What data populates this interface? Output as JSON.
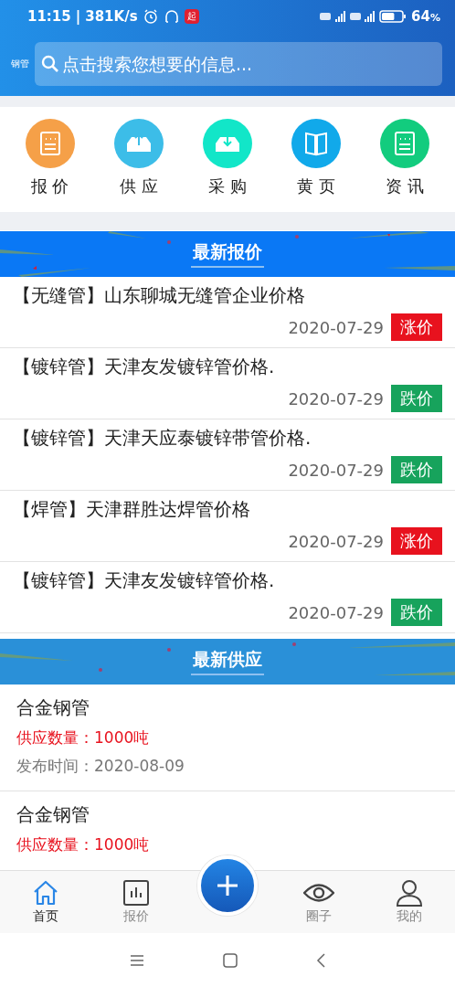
{
  "status_bar": {
    "time": "11:15",
    "separator": "|",
    "speed": "381K/s",
    "app_badge": "起",
    "battery_text": "64",
    "battery_unit": "%"
  },
  "header": {
    "logo": "钢管",
    "search": {
      "placeholder": "点击搜索您想要的信息..."
    }
  },
  "shortcuts": [
    {
      "label": "报 价",
      "kind": "doc",
      "color": "#f5a048"
    },
    {
      "label": "供 应",
      "kind": "upload",
      "color": "#3cbde8"
    },
    {
      "label": "采 购",
      "kind": "download",
      "color": "#12e6c8"
    },
    {
      "label": "黄 页",
      "kind": "book",
      "color": "#11a9ea"
    },
    {
      "label": "资 讯",
      "kind": "doc",
      "color": "#12cc7e"
    }
  ],
  "quotes": {
    "title": "最新报价",
    "items": [
      {
        "title": "【无缝管】山东聊城无缝管企业价格",
        "date": "2020-07-29",
        "tag": "涨价",
        "kind": "up"
      },
      {
        "title": "【镀锌管】天津友发镀锌管价格.",
        "date": "2020-07-29",
        "tag": "跌价",
        "kind": "down"
      },
      {
        "title": "【镀锌管】天津天应泰镀锌带管价格.",
        "date": "2020-07-29",
        "tag": "跌价",
        "kind": "down"
      },
      {
        "title": "【焊管】天津群胜达焊管价格",
        "date": "2020-07-29",
        "tag": "涨价",
        "kind": "up"
      },
      {
        "title": "【镀锌管】天津友发镀锌管价格.",
        "date": "2020-07-29",
        "tag": "跌价",
        "kind": "down"
      }
    ]
  },
  "supply": {
    "title": "最新供应",
    "items": [
      {
        "name": "合金钢管",
        "quantity": "供应数量：1000吨",
        "published": "发布时间：2020-08-09"
      },
      {
        "name": "合金钢管",
        "quantity": "供应数量：1000吨"
      }
    ]
  },
  "tab_bar": [
    {
      "label": "首页",
      "kind": "home",
      "selected": true
    },
    {
      "label": "报价",
      "kind": "chart",
      "selected": false
    },
    {
      "kind": "add",
      "selected": false
    },
    {
      "label": "圈子",
      "kind": "eye",
      "selected": false
    },
    {
      "label": "我的",
      "kind": "person",
      "selected": false
    }
  ]
}
